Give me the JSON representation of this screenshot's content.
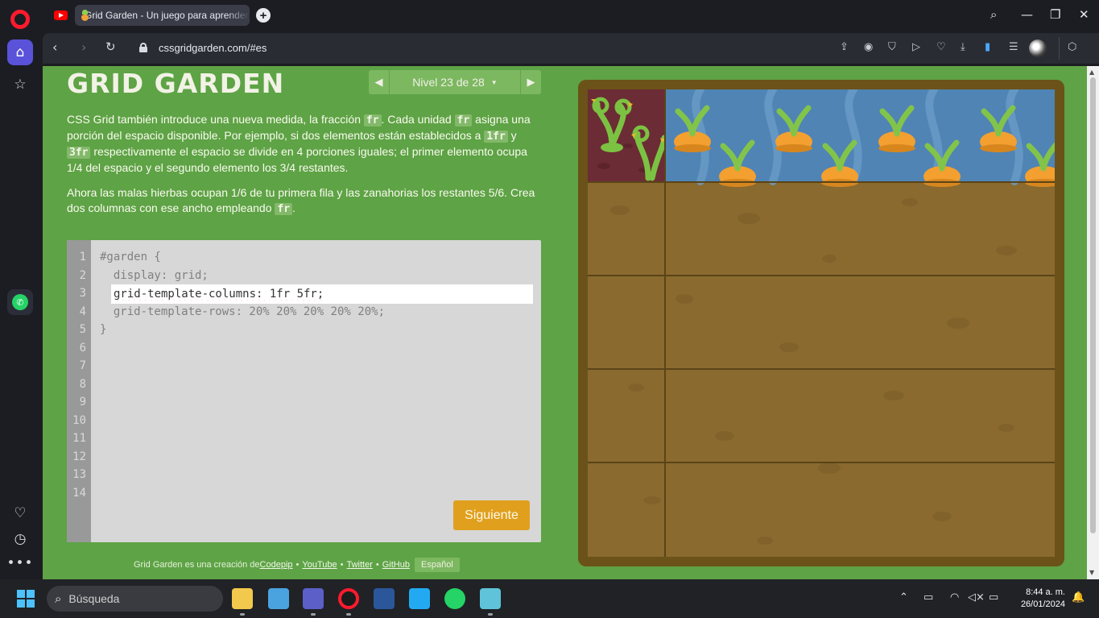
{
  "browser": {
    "tab_title": "Grid Garden - Un juego para aprender CSS grid",
    "url": "cssgridgarden.com/#es",
    "new_tab": "+",
    "window_buttons": [
      "⌕",
      "—",
      "❐",
      "✕"
    ]
  },
  "sidebar": {
    "icons": [
      "opera-logo",
      "home-icon",
      "star-icon",
      "whatsapp-icon",
      "heart-icon",
      "history-icon",
      "more-icon"
    ]
  },
  "game": {
    "title": "GRID GARDEN",
    "level_label": "Nivel 23 de 28",
    "level_caret": "▼",
    "prev_arrow": "◀",
    "next_arrow": "▶",
    "instructions_1": [
      "CSS Grid también introduce una nueva medida, la fracción ",
      "fr",
      ". Cada unidad ",
      "fr",
      " asigna una porción del espacio disponible. Por ejemplo, si dos elementos están establecidos a ",
      "1fr",
      " y ",
      "3fr",
      " respectivamente el espacio se divide en 4 porciones iguales; el primer elemento ocupa 1/4 del espacio y el segundo elemento los 3/4 restantes."
    ],
    "instructions_2": [
      "Ahora las malas hierbas ocupan 1/6 de tu primera fila y las zanahorias los restantes 5/6. Crea dos columnas con ese ancho empleando ",
      "fr",
      "."
    ],
    "editor": {
      "line_numbers": [
        "1",
        "2",
        "3",
        "4",
        "5",
        "6",
        "7",
        "8",
        "9",
        "10",
        "11",
        "12",
        "13",
        "14"
      ],
      "line1": "#garden {",
      "line2": "  display: grid;",
      "input_value": "grid-template-columns: 1fr 5fr;",
      "line4": "  grid-template-rows: 20% 20% 20% 20% 20%;",
      "line5": "}"
    },
    "next_button": "Siguiente",
    "footer": {
      "prefix": "Grid Garden es una creación de ",
      "links": [
        "Codepip",
        "YouTube",
        "Twitter",
        "GitHub"
      ],
      "separator": "•",
      "language": "Español"
    },
    "garden": {
      "columns": "1fr 5fr",
      "rows": 5,
      "weed_color": "#6b2c35",
      "water_color": "#4f84b5",
      "soil_color": "#8a6a2e"
    }
  },
  "taskbar": {
    "search_placeholder": "Búsqueda",
    "time": "8:44 a. m.",
    "date": "26/01/2024"
  }
}
